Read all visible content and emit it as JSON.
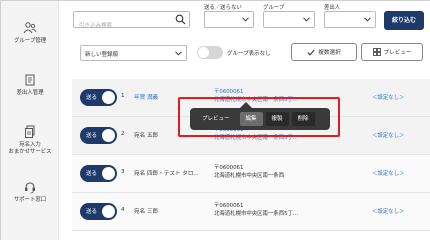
{
  "sidebar": {
    "items": [
      {
        "label": "グループ管理",
        "icon": "group-icon"
      },
      {
        "label": "差出人管理",
        "icon": "sender-icon"
      },
      {
        "label_line1": "宛名入力",
        "label_line2": "おまかせサービス",
        "icon": "document-icon"
      },
      {
        "label": "サポート窓口",
        "icon": "headset-icon"
      }
    ]
  },
  "filters": {
    "search_placeholder": "引き込み検索",
    "send_label": "送る／送らない",
    "group_label": "グループ",
    "sender_label": "差出人",
    "narrow_button": "絞り込む"
  },
  "toolbar": {
    "sort_value": "新しい登録順",
    "group_toggle_label": "グループ表示なし",
    "multi_select_button": "複数選択",
    "preview_button": "プレビュー"
  },
  "rows": [
    {
      "toggle_label": "送る",
      "num": "1",
      "name": "年賀 満義",
      "postal": "〒0600061",
      "address": "北海道札幌市中央区南一条西5丁...",
      "setting": "＜設定なし＞"
    },
    {
      "toggle_label": "送る",
      "num": "2",
      "name": "宛名 五郎",
      "postal": "〒0600061",
      "address": "北海道札幌市中央区南一条西5丁...",
      "setting": "＜設定なし＞"
    },
    {
      "toggle_label": "送る",
      "num": "3",
      "name": "宛名 四郎・テスト タロ...",
      "postal": "〒0600061",
      "address": "北海道札幌市中央区南一条西",
      "setting": "＜設定なし＞"
    },
    {
      "toggle_label": "送る",
      "num": "4",
      "name": "宛名 三郎",
      "postal": "〒0600061",
      "address": "北海道札幌市中央区南一条西5丁...",
      "setting": "＜設定なし＞"
    }
  ],
  "popup": {
    "items": [
      "プレビュー",
      "編集",
      "複製",
      "削除"
    ]
  },
  "colors": {
    "accent": "#1d3a6b",
    "link": "#2e6fc7",
    "highlight": "#e11d1d",
    "popup_bg": "#3a3a3a"
  }
}
